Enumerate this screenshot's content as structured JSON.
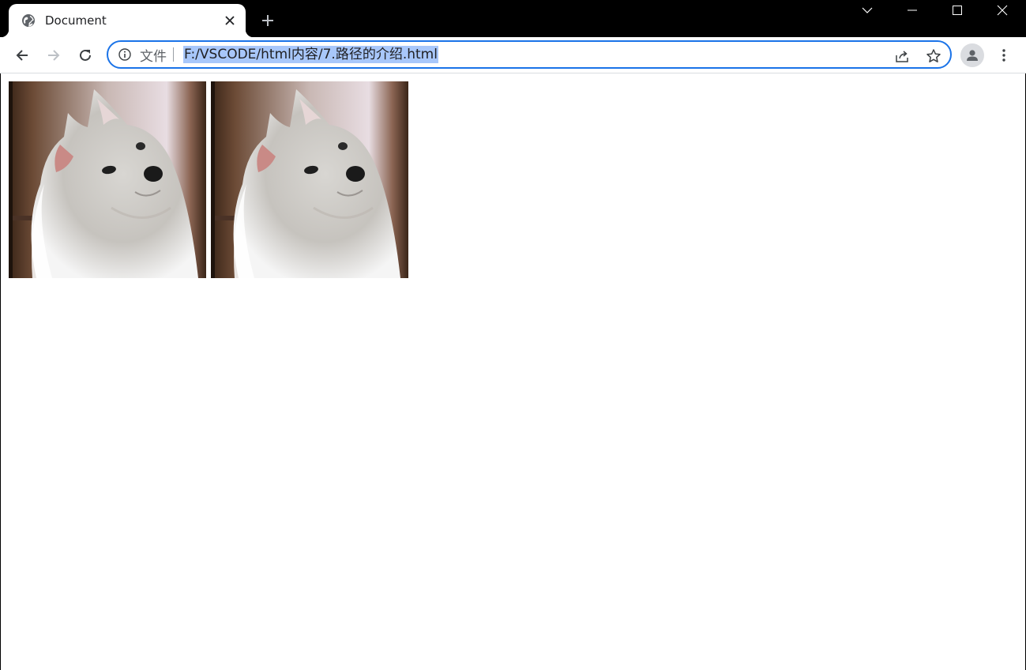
{
  "tab": {
    "title": "Document",
    "favicon": "globe-icon",
    "close_icon": "close-icon"
  },
  "window_controls": [
    "tab-search-icon",
    "minimize-icon",
    "maximize-icon",
    "close-window-icon"
  ],
  "toolbar": {
    "back_icon": "back-arrow-icon",
    "forward_icon": "forward-arrow-icon",
    "reload_icon": "reload-icon"
  },
  "omnibox": {
    "scheme_label": "文件",
    "url": "F:/VSCODE/html内容/7.路径的介绍.html",
    "share_icon": "share-icon",
    "bookmark_icon": "star-icon"
  },
  "colors": {
    "accent": "#1a73e8",
    "selection": "#a8c7fa",
    "frame": "#000000"
  },
  "content": {
    "images": [
      {
        "subject": "white-samoyed-puppy"
      },
      {
        "subject": "white-samoyed-puppy"
      }
    ]
  }
}
